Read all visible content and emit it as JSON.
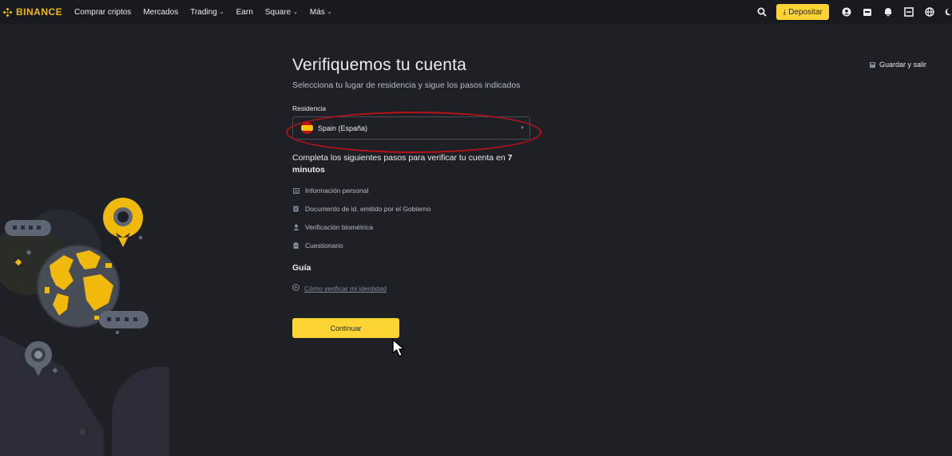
{
  "header": {
    "logo_text": "BINANCE",
    "nav": [
      {
        "label": "Comprar criptos",
        "dropdown": false
      },
      {
        "label": "Mercados",
        "dropdown": false
      },
      {
        "label": "Trading",
        "dropdown": true
      },
      {
        "label": "Earn",
        "dropdown": false
      },
      {
        "label": "Square",
        "dropdown": true
      },
      {
        "label": "Más",
        "dropdown": true
      }
    ],
    "deposit_label": "Depositar",
    "icons": [
      "search-icon",
      "user-icon",
      "wallet-icon",
      "bell-icon",
      "download-icon",
      "globe-icon",
      "theme-icon"
    ]
  },
  "page": {
    "title": "Verifiquemos tu cuenta",
    "subtitle": "Selecciona tu lugar de residencia y sigue los pasos indicados",
    "residence_label": "Residencia",
    "residence_value": "Spain (España)",
    "steps_intro": "Completa los siguientes pasos para verificar tu cuenta en ",
    "steps_time": "7 minutos",
    "steps": [
      {
        "label": "Información personal",
        "icon": "id-card-icon"
      },
      {
        "label": "Documento de id. emitido por el Gobierno",
        "icon": "document-icon"
      },
      {
        "label": "Verificación biométrica",
        "icon": "person-icon"
      },
      {
        "label": "Cuestionario",
        "icon": "clipboard-icon"
      }
    ],
    "guide_title": "Guía",
    "guide_link": "Cómo verificar mi identidad",
    "continue_label": "Continuar",
    "save_exit_label": "Guardar y salir"
  },
  "colors": {
    "accent": "#fcd535",
    "background": "#1e2026",
    "annotation": "#b5121b"
  }
}
